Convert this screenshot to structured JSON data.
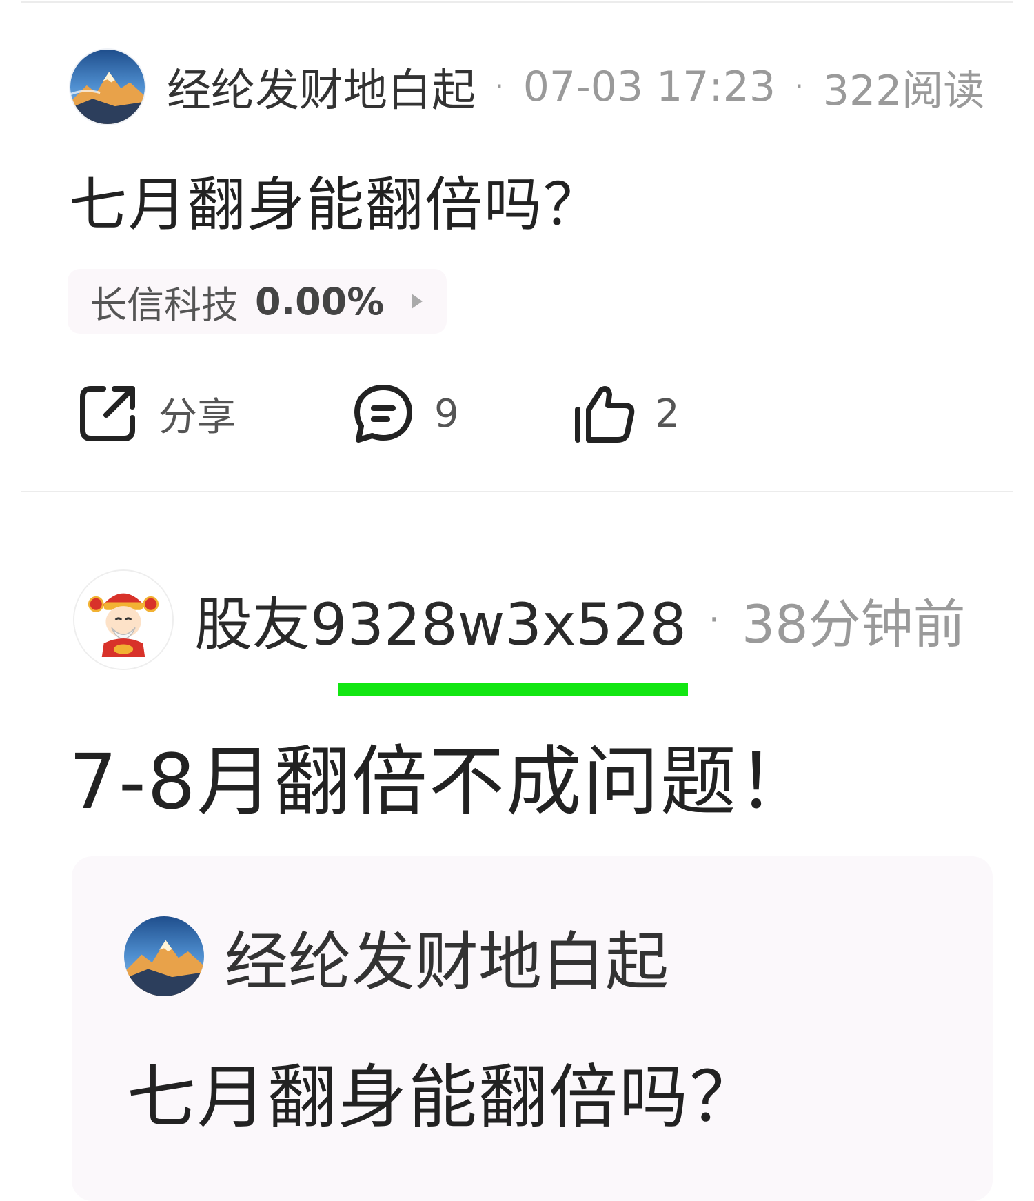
{
  "post": {
    "author": "经纶发财地白起",
    "time": "07-03 17:23",
    "reads": "322阅读",
    "title": "七月翻身能翻倍吗？",
    "stock": {
      "name": "长信科技",
      "change": "0.00%"
    },
    "actions": {
      "share": "分享",
      "comments": "9",
      "likes": "2"
    }
  },
  "comment": {
    "author": "股友9328w3x528",
    "time": "38分钟前",
    "text": "7-8月翻倍不成问题！",
    "highlight_color": "#12e612",
    "quote": {
      "author": "经纶发财地白起",
      "title": "七月翻身能翻倍吗？"
    }
  },
  "icons": [
    "share-icon",
    "comment-icon",
    "thumbs-up-icon",
    "chevron-right-icon"
  ],
  "colors": {
    "meta_gray": "#9a9a9a",
    "chip_bg": "#fbf7fa",
    "quote_bg": "#fbf8fb"
  }
}
